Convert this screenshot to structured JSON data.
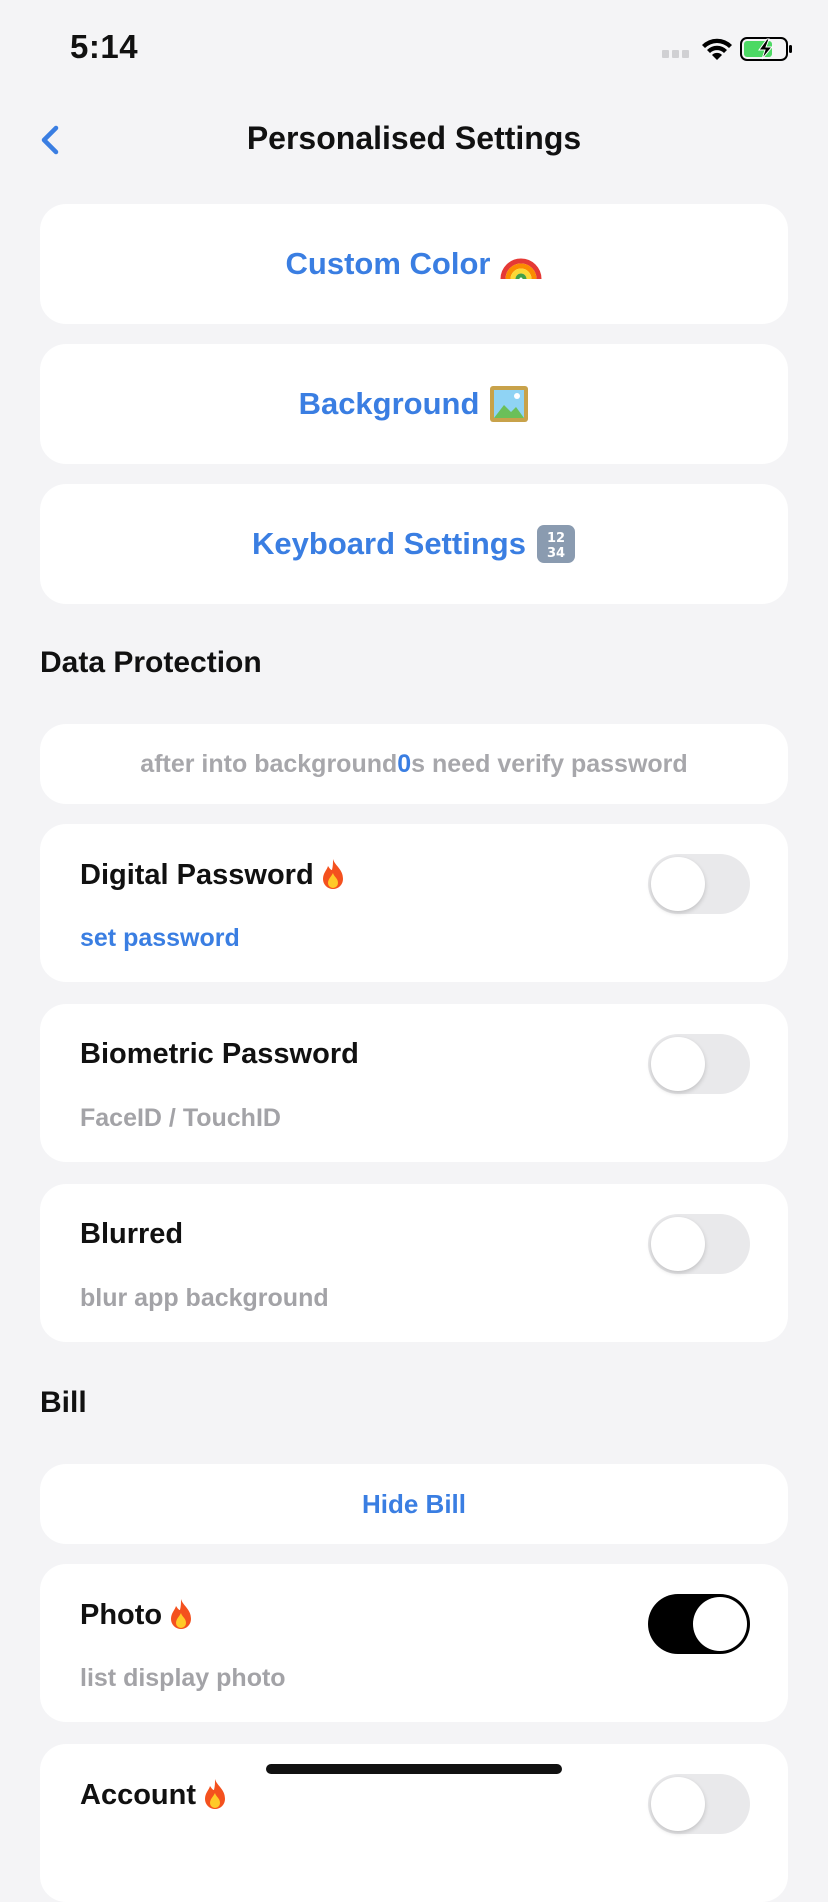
{
  "status_bar": {
    "time": "5:14"
  },
  "nav": {
    "title": "Personalised Settings"
  },
  "buttons": {
    "custom_color": {
      "label": "Custom Color",
      "icon": "rainbow-icon"
    },
    "background": {
      "label": "Background",
      "icon": "picture-icon"
    },
    "keyboard_settings": {
      "label": "Keyboard Settings",
      "icon": "number-keypad-icon"
    }
  },
  "data_protection": {
    "heading": "Data Protection",
    "lock_info": {
      "prefix": "after into background ",
      "seconds": "0",
      "suffix": "s need verify password"
    },
    "digital_password": {
      "title": "Digital Password",
      "action": "set password",
      "enabled": false
    },
    "biometric_password": {
      "title": "Biometric Password",
      "subtitle": "FaceID / TouchID",
      "enabled": false
    },
    "blurred": {
      "title": "Blurred",
      "subtitle": "blur app background",
      "enabled": false
    }
  },
  "bill": {
    "heading": "Bill",
    "hide_bill": "Hide Bill",
    "photo": {
      "title": "Photo",
      "subtitle": "list display photo",
      "enabled": true
    },
    "account": {
      "title": "Account",
      "enabled": false
    }
  },
  "colors": {
    "accent": "#3a7ee2",
    "background": "#f4f4f6",
    "card": "#ffffff",
    "muted_text": "#a3a3a7",
    "toggle_on": "#000000",
    "toggle_off": "#e9e9eb"
  }
}
